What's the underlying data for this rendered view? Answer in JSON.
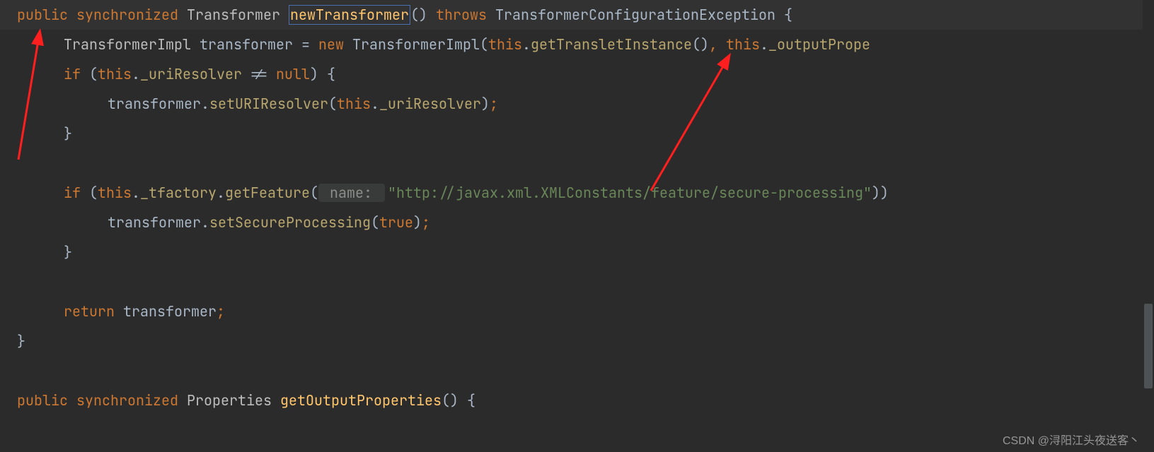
{
  "code": {
    "l1": {
      "public": "public",
      "sync": "synchronized",
      "rettype": "Transformer ",
      "method": "newTransformer",
      "parens": "()",
      "throws": "throws",
      "exc": "TransformerConfigurationException",
      "brace": " {"
    },
    "l2": {
      "type1": "TransformerImpl",
      "var": " transformer = ",
      "newkw": "new",
      "sp": " ",
      "ctor": "TransformerImpl",
      "lp": "(",
      "this1": "this",
      "dot1": ".",
      "call1": "getTransletInstance",
      "after1": "()",
      "comma": ", ",
      "this2": "this",
      "dot2": ".",
      "field": "_outputPrope"
    },
    "l3": {
      "ifkw": "if ",
      "lp": "(",
      "this": "this",
      "dot": ".",
      "field": "_uriResolver",
      "cond": " != ",
      "nullkw": "null",
      "rp": ") {"
    },
    "l4": {
      "obj": "transformer.",
      "call": "setURIResolver",
      "lp": "(",
      "this": "this",
      "dot": ".",
      "field": "_uriResolver",
      "rp": ")",
      "semi": ";"
    },
    "l5": {
      "brace": "}"
    },
    "l7": {
      "ifkw": "if ",
      "lp": "(",
      "this": "this",
      "dot1": ".",
      "field": "_tfactory",
      "dot2": ".",
      "call": "getFeature",
      "lp2": "(",
      "hint": " name: ",
      "str": "\"http://javax.xml.XMLConstants/feature/secure-processing\"",
      "rp": "))"
    },
    "l8": {
      "obj": "transformer.",
      "call": "setSecureProcessing",
      "lp": "(",
      "truekw": "true",
      "rp": ")",
      "semi": ";"
    },
    "l9": {
      "brace": "}"
    },
    "l11": {
      "ret": "return",
      "val": " transformer",
      "semi": ";"
    },
    "l12": {
      "brace": "}"
    },
    "l14": {
      "public": "public",
      "sync": "synchronized",
      "rettype": "Properties ",
      "method": "getOutputProperties",
      "tail": "() {"
    }
  },
  "watermark": "CSDN @浔阳江头夜送客丶",
  "colors": {
    "keyword": "#cc7832",
    "method_def": "#ffc66d",
    "string": "#6a8759",
    "text": "#a9b7c6",
    "bg": "#2b2b2b",
    "arrow": "#ff1f1f"
  }
}
